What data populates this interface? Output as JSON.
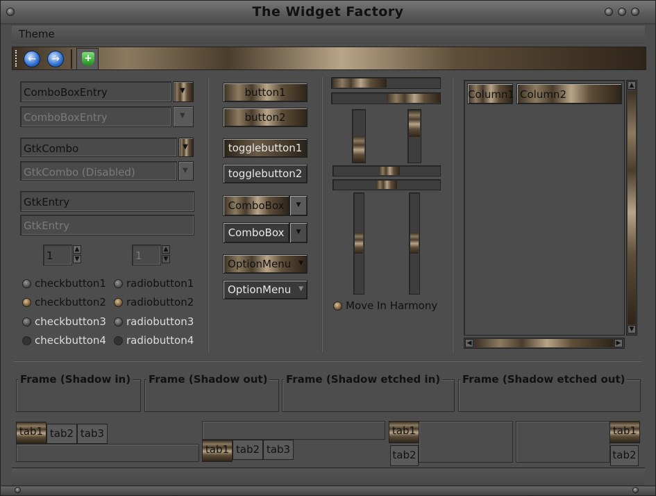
{
  "window": {
    "title": "The Widget Factory"
  },
  "menu": {
    "items": [
      "Theme"
    ]
  },
  "toolbar": {
    "back_icon": "back-arrow-icon",
    "forward_icon": "forward-arrow-icon",
    "shield_icon": "shield-icon"
  },
  "combos": {
    "cbe1": "ComboBoxEntry",
    "cbe2": "ComboBoxEntry",
    "gtk1": "GtkCombo",
    "gtk2": "GtkCombo (Disabled)",
    "entry1": "GtkEntry",
    "entry2": "GtkEntry",
    "spin1": "1",
    "spin2": "1"
  },
  "checks": [
    "checkbutton1",
    "checkbutton2",
    "checkbutton3",
    "checkbutton4"
  ],
  "radios": [
    "radiobutton1",
    "radiobutton2",
    "radiobutton3",
    "radiobutton4"
  ],
  "buttons": {
    "b1": "button1",
    "b2": "button2",
    "t1": "togglebutton1",
    "t2": "togglebutton2",
    "cb1": "ComboBox",
    "cb2": "ComboBox",
    "om1": "OptionMenu",
    "om2": "OptionMenu"
  },
  "scales": {
    "harmony_label": "Move In Harmony"
  },
  "list": {
    "columns": [
      "Column1",
      "Column2"
    ]
  },
  "frames": [
    "Frame (Shadow in)",
    "Frame (Shadow out)",
    "Frame (Shadow etched in)",
    "Frame (Shadow etched out)"
  ],
  "tabs": [
    "tab1",
    "tab2",
    "tab3"
  ]
}
